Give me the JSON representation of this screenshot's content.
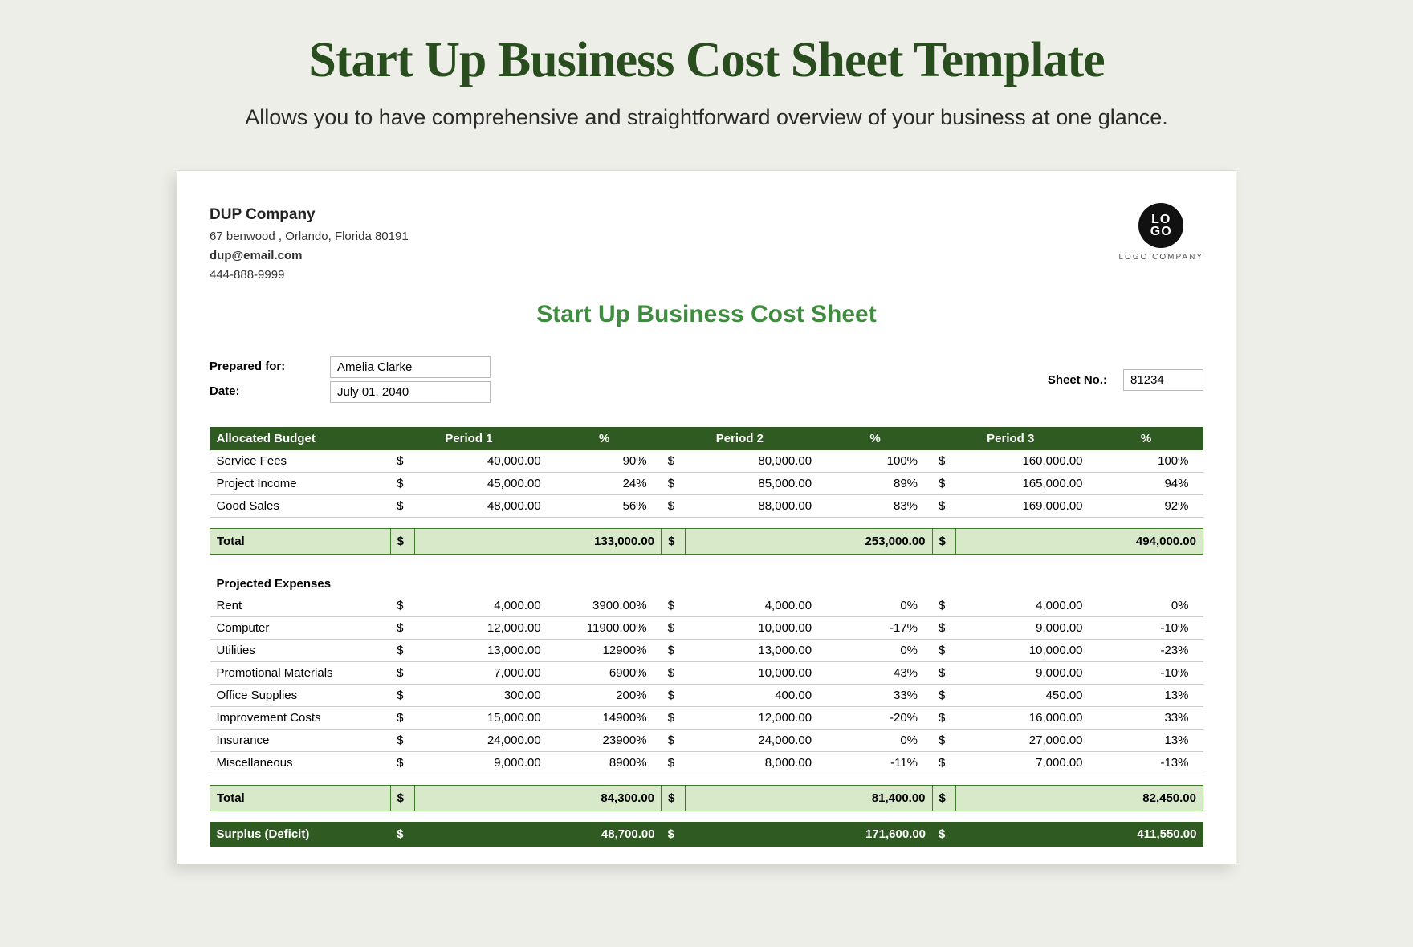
{
  "page": {
    "title": "Start Up Business Cost Sheet Template",
    "subtitle": "Allows you to have comprehensive and straightforward overview of your business at one glance."
  },
  "company": {
    "name": "DUP Company",
    "address": "67 benwood , Orlando, Florida 80191",
    "email": "dup@email.com",
    "phone": "444-888-9999"
  },
  "logo": {
    "line1": "LO",
    "line2": "GO",
    "caption": "LOGO COMPANY"
  },
  "sheet": {
    "title": "Start Up Business Cost Sheet",
    "prepared_for_label": "Prepared for:",
    "prepared_for": "Amelia Clarke",
    "date_label": "Date:",
    "date": "July 01, 2040",
    "sheet_no_label": "Sheet No.:",
    "sheet_no": "81234"
  },
  "headers": {
    "allocated": "Allocated Budget",
    "p1": "Period 1",
    "p2": "Period 2",
    "p3": "Period 3",
    "pct": "%"
  },
  "budget_rows": [
    {
      "label": "Service Fees",
      "p1": "40,000.00",
      "pc1": "90%",
      "p2": "80,000.00",
      "pc2": "100%",
      "p3": "160,000.00",
      "pc3": "100%"
    },
    {
      "label": "Project Income",
      "p1": "45,000.00",
      "pc1": "24%",
      "p2": "85,000.00",
      "pc2": "89%",
      "p3": "165,000.00",
      "pc3": "94%"
    },
    {
      "label": "Good Sales",
      "p1": "48,000.00",
      "pc1": "56%",
      "p2": "88,000.00",
      "pc2": "83%",
      "p3": "169,000.00",
      "pc3": "92%"
    }
  ],
  "budget_total": {
    "label": "Total",
    "p1": "133,000.00",
    "p2": "253,000.00",
    "p3": "494,000.00"
  },
  "expenses_heading": "Projected Expenses",
  "expense_rows": [
    {
      "label": "Rent",
      "p1": "4,000.00",
      "pc1": "3900.00%",
      "p2": "4,000.00",
      "pc2": "0%",
      "p3": "4,000.00",
      "pc3": "0%"
    },
    {
      "label": "Computer",
      "p1": "12,000.00",
      "pc1": "11900.00%",
      "p2": "10,000.00",
      "pc2": "-17%",
      "p3": "9,000.00",
      "pc3": "-10%"
    },
    {
      "label": "Utilities",
      "p1": "13,000.00",
      "pc1": "12900%",
      "p2": "13,000.00",
      "pc2": "0%",
      "p3": "10,000.00",
      "pc3": "-23%"
    },
    {
      "label": "Promotional Materials",
      "p1": "7,000.00",
      "pc1": "6900%",
      "p2": "10,000.00",
      "pc2": "43%",
      "p3": "9,000.00",
      "pc3": "-10%"
    },
    {
      "label": "Office Supplies",
      "p1": "300.00",
      "pc1": "200%",
      "p2": "400.00",
      "pc2": "33%",
      "p3": "450.00",
      "pc3": "13%"
    },
    {
      "label": "Improvement Costs",
      "p1": "15,000.00",
      "pc1": "14900%",
      "p2": "12,000.00",
      "pc2": "-20%",
      "p3": "16,000.00",
      "pc3": "33%"
    },
    {
      "label": "Insurance",
      "p1": "24,000.00",
      "pc1": "23900%",
      "p2": "24,000.00",
      "pc2": "0%",
      "p3": "27,000.00",
      "pc3": "13%"
    },
    {
      "label": "Miscellaneous",
      "p1": "9,000.00",
      "pc1": "8900%",
      "p2": "8,000.00",
      "pc2": "-11%",
      "p3": "7,000.00",
      "pc3": "-13%"
    }
  ],
  "expense_total": {
    "label": "Total",
    "p1": "84,300.00",
    "p2": "81,400.00",
    "p3": "82,450.00"
  },
  "surplus": {
    "label": "Surplus (Deficit)",
    "p1": "48,700.00",
    "p2": "171,600.00",
    "p3": "411,550.00"
  },
  "currency": "$"
}
